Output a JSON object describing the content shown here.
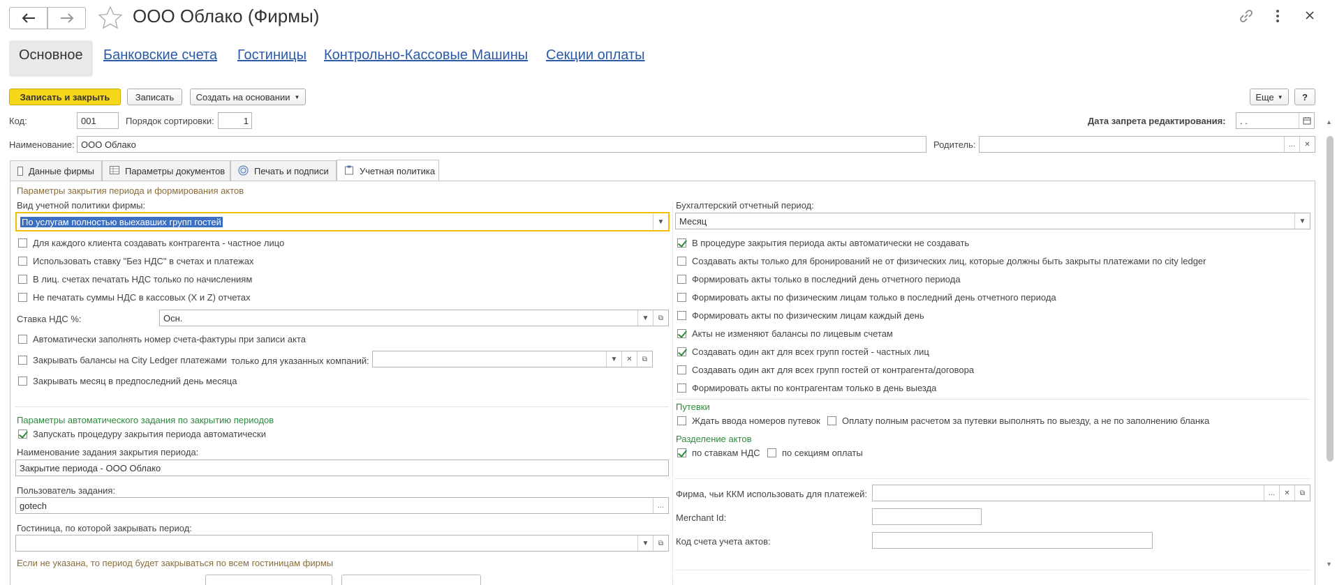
{
  "window": {
    "title": "ООО Облако (Фирмы)"
  },
  "nav_tabs": [
    "Основное",
    "Банковские счета",
    "Гостиницы",
    "Контрольно-Кассовые Машины",
    "Секции оплаты"
  ],
  "toolbar": {
    "save_close": "Записать и закрыть",
    "save": "Записать",
    "create_based": "Создать на основании",
    "more": "Еще",
    "help": "?"
  },
  "header": {
    "code_label": "Код:",
    "code_value": "001",
    "sort_label": "Порядок сортировки:",
    "sort_value": "1",
    "lock_date_label": "Дата запрета редактирования:",
    "lock_date_value": " .  .",
    "name_label": "Наименование:",
    "name_value": "ООО Облако",
    "parent_label": "Родитель:",
    "parent_value": ""
  },
  "sub_tabs": [
    "Данные фирмы",
    "Параметры документов",
    "Печать и подписи",
    "Учетная политика"
  ],
  "left": {
    "group1": "Параметры закрытия периода и формирования актов",
    "policy_label": "Вид учетной политики фирмы:",
    "policy_value": "По услугам полностью выехавших групп гостей",
    "cb1": "Для каждого клиента создавать контрагента - частное лицо",
    "cb2": "Использовать ставку \"Без НДС\" в счетах и платежах",
    "cb3": "В лиц. счетах печатать НДС только по начислениям",
    "cb4": "Не печатать суммы НДС в кассовых (X и Z) отчетах",
    "vat_label": "Ставка НДС %:",
    "vat_value": "Осн.",
    "cb5": "Автоматически заполнять номер счета-фактуры при записи акта",
    "cb6": "Закрывать балансы на City Ledger платежами",
    "only_companies": "только для указанных компаний:",
    "cb7": "Закрывать месяц в предпоследний день месяца",
    "group2": "Параметры автоматического задания по закрытию периодов",
    "cb8": "Запускать процедуру закрытия периода автоматически",
    "job_name_label": "Наименование задания закрытия периода:",
    "job_name_value": "Закрытие периода - ООО Облако",
    "job_user_label": "Пользователь задания:",
    "job_user_value": "gotech",
    "hotel_label": "Гостиница, по которой закрывать период:",
    "hotel_value": "",
    "hotel_note": "Если  не указана, то период будет закрываться по всем гостиницам фирмы"
  },
  "right": {
    "period_label": "Бухгалтерский отчетный период:",
    "period_value": "Месяц",
    "cb1": "В процедуре закрытия периода акты автоматически не создавать",
    "cb2": "Создавать акты только для бронирований не от физических лиц, которые должны быть закрыты платежами по city ledger",
    "cb3": "Формировать акты только в последний день отчетного периода",
    "cb4": "Формировать акты по физическим лицам только в последний день отчетного периода",
    "cb5": "Формировать акты по физическим лицам каждый день",
    "cb6": "Акты не изменяют балансы по лицевым счетам",
    "cb7": "Создавать один акт для всех групп гостей - частных лиц",
    "cb8": "Создавать один акт для всех групп гостей от контрагента/договора",
    "cb9": "Формировать акты по контрагентам только в день выезда",
    "vouchers_group": "Путевки",
    "cb10": "Ждать ввода номеров путевок",
    "cb11": "Оплату полным расчетом за путевки выполнять по выезду, а не по заполнению бланка",
    "split_group": "Разделение актов",
    "cb12": "по ставкам НДС",
    "cb13": "по секциям оплаты",
    "kkm_label": "Фирма, чьи ККМ использовать для платежей:",
    "kkm_value": "",
    "merchant_label": "Merchant Id:",
    "merchant_value": "",
    "account_label": "Код счета учета актов:",
    "account_value": ""
  },
  "checkbox_states": {
    "left": [
      false,
      false,
      false,
      false,
      false,
      false,
      false,
      true
    ],
    "right": [
      true,
      false,
      false,
      false,
      false,
      true,
      true,
      false,
      false,
      false,
      false,
      true,
      false
    ]
  },
  "colors": {
    "accent": "#f7d71a",
    "link": "#2a5aa8",
    "check": "#2e8b3e",
    "group_title": "#8a6d3b",
    "focus": "#f0c000"
  }
}
